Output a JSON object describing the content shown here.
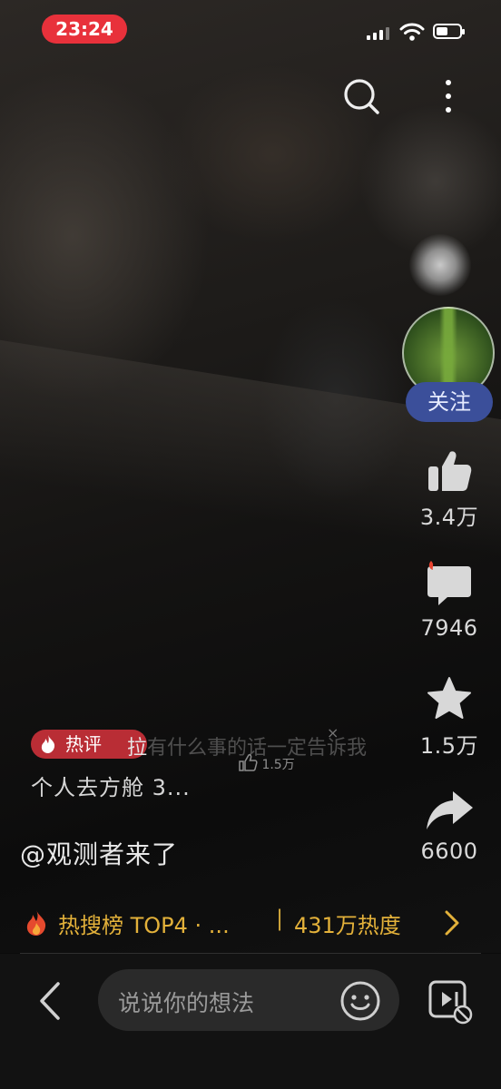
{
  "status_bar": {
    "time": "23:24",
    "accent_color": "#e8313b"
  },
  "top_bar": {
    "search_icon": "search-icon",
    "more_icon": "more-vertical-icon"
  },
  "creator": {
    "follow_label": "关注",
    "follow_color": "#3b4f9a"
  },
  "actions": {
    "like_count": "3.4万",
    "comment_count": "7946",
    "favorite_count": "1.5万",
    "share_count": "6600"
  },
  "hot_comment": {
    "badge_label": "热评",
    "badge_color": "#d7323c",
    "text_start": "拉",
    "text_faded": "有什么事的话一定告诉我",
    "like_count": "1.5万",
    "close_glyph": "×",
    "text_line2": "个人去方舱 3..."
  },
  "author_handle": "@观测者来了",
  "hot_search": {
    "rank_text": "热搜榜 TOP4 · ...",
    "separator": "|",
    "heat_text": "431万热度",
    "accent_color": "#e3b13a"
  },
  "bottom_bar": {
    "back_icon": "back-chevron-icon",
    "input_placeholder": "说说你的想法",
    "emoji_icon": "emoji-icon",
    "screen_icon": "screen-off-icon"
  }
}
